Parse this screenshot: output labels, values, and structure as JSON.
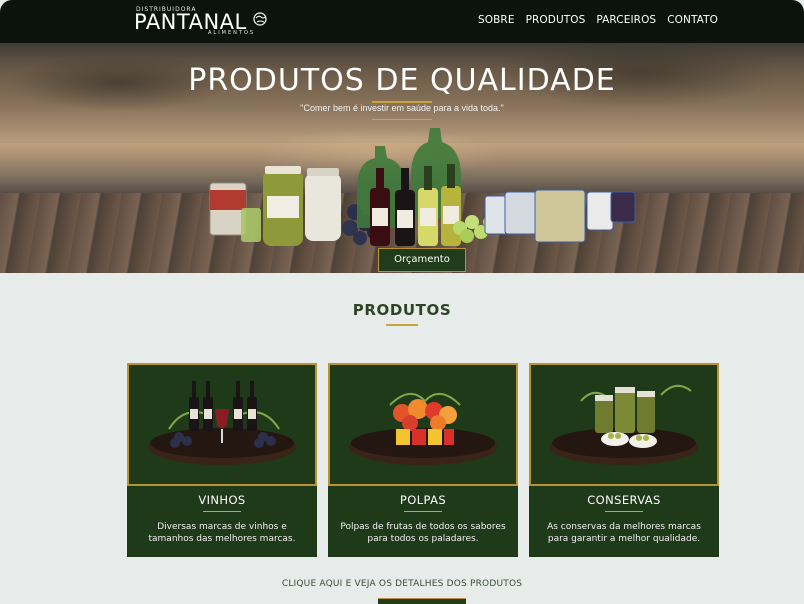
{
  "header": {
    "logo_top": "DISTRIBUIDORA",
    "logo_main": "PANTANAL",
    "logo_sub": "ALIMENTOS",
    "nav": [
      "SOBRE",
      "PRODUTOS",
      "PARCEIROS",
      "CONTATO"
    ]
  },
  "hero": {
    "title": "PRODUTOS DE QUALIDADE",
    "quote": "\"Comer bem é investir em saúde para a vida toda.\"",
    "cta_label": "Orçamento"
  },
  "section": {
    "title": "PRODUTOS",
    "cards": [
      {
        "name": "VINHOS",
        "desc": "Diversas marcas de vinhos e tamanhos das melhores marcas."
      },
      {
        "name": "POLPAS",
        "desc": "Polpas de frutas de todos os sabores para todos os paladares."
      },
      {
        "name": "CONSERVAS",
        "desc": "As conservas da melhores marcas para garantir a melhor qualidade."
      }
    ],
    "more_text": "CLIQUE AQUI E VEJA OS DETALHES DOS PRODUTOS"
  },
  "colors": {
    "header_bg": "#0c130c",
    "card_green": "#1f3a19",
    "gold": "#c9a33b",
    "page_bg": "#e7ecea"
  }
}
